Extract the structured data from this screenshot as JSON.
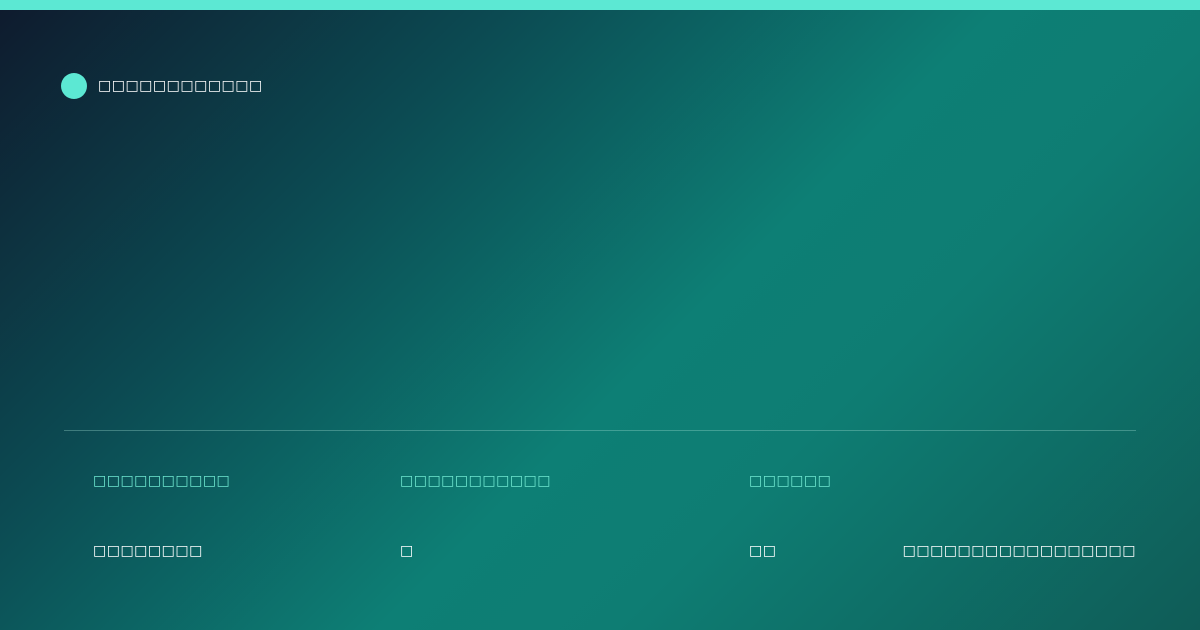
{
  "brand": {
    "name": "□□□□□□□□□□□□"
  },
  "meta": {
    "items": [
      {
        "label": "□□□□□□□□□□",
        "value": "□□□□□□□□"
      },
      {
        "label": "□□□□□□□□□□□",
        "value": "□"
      },
      {
        "label": "□□□□□□",
        "value": "□□"
      }
    ],
    "extra_value": "□□□□□□□□□□□□□□□□□"
  },
  "colors": {
    "accent": "#5ce8d3",
    "label": "#6ee6cf",
    "text": "#ffffff"
  }
}
